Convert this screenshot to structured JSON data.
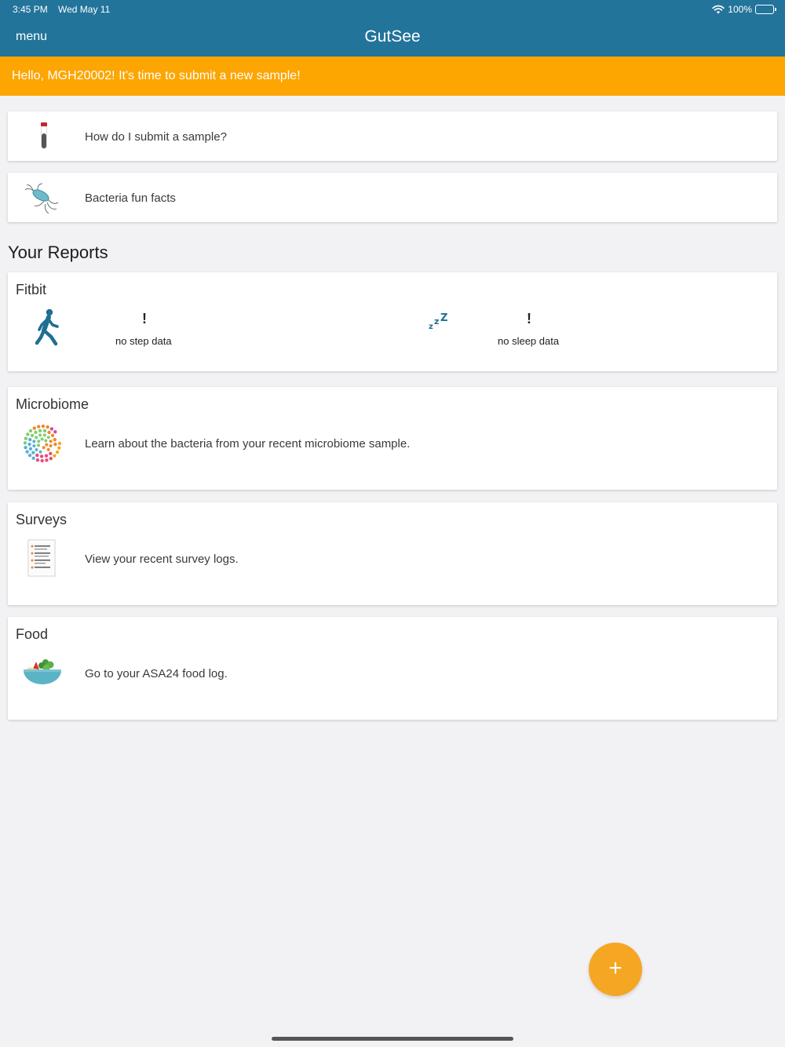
{
  "status_bar": {
    "time": "3:45 PM",
    "date": "Wed May 11",
    "battery": "100%"
  },
  "header": {
    "menu_label": "menu",
    "title": "GutSee"
  },
  "banner": {
    "text": "Hello, MGH20002! It's time to submit a new sample!"
  },
  "quick_links": [
    {
      "label": "How do I submit a sample?",
      "icon": "test-tube-icon"
    },
    {
      "label": "Bacteria fun facts",
      "icon": "bacteria-icon"
    }
  ],
  "reports": {
    "title": "Your Reports",
    "fitbit": {
      "title": "Fitbit",
      "steps": {
        "alert": "!",
        "text": "no step data",
        "icon": "walking-person-icon"
      },
      "sleep": {
        "alert": "!",
        "text": "no sleep data",
        "icon": "moon-sleep-icon"
      }
    },
    "microbiome": {
      "title": "Microbiome",
      "text": "Learn about the bacteria from your recent microbiome sample.",
      "icon": "microbiome-circle-icon"
    },
    "surveys": {
      "title": "Surveys",
      "text": "View your recent survey logs.",
      "icon": "survey-document-icon"
    },
    "food": {
      "title": "Food",
      "text": "Go to your ASA24 food log.",
      "icon": "salad-bowl-icon"
    }
  },
  "fab": {
    "label": "+"
  },
  "colors": {
    "header": "#22749a",
    "banner": "#fda500",
    "fab": "#f5a623",
    "background": "#f2f2f4"
  }
}
